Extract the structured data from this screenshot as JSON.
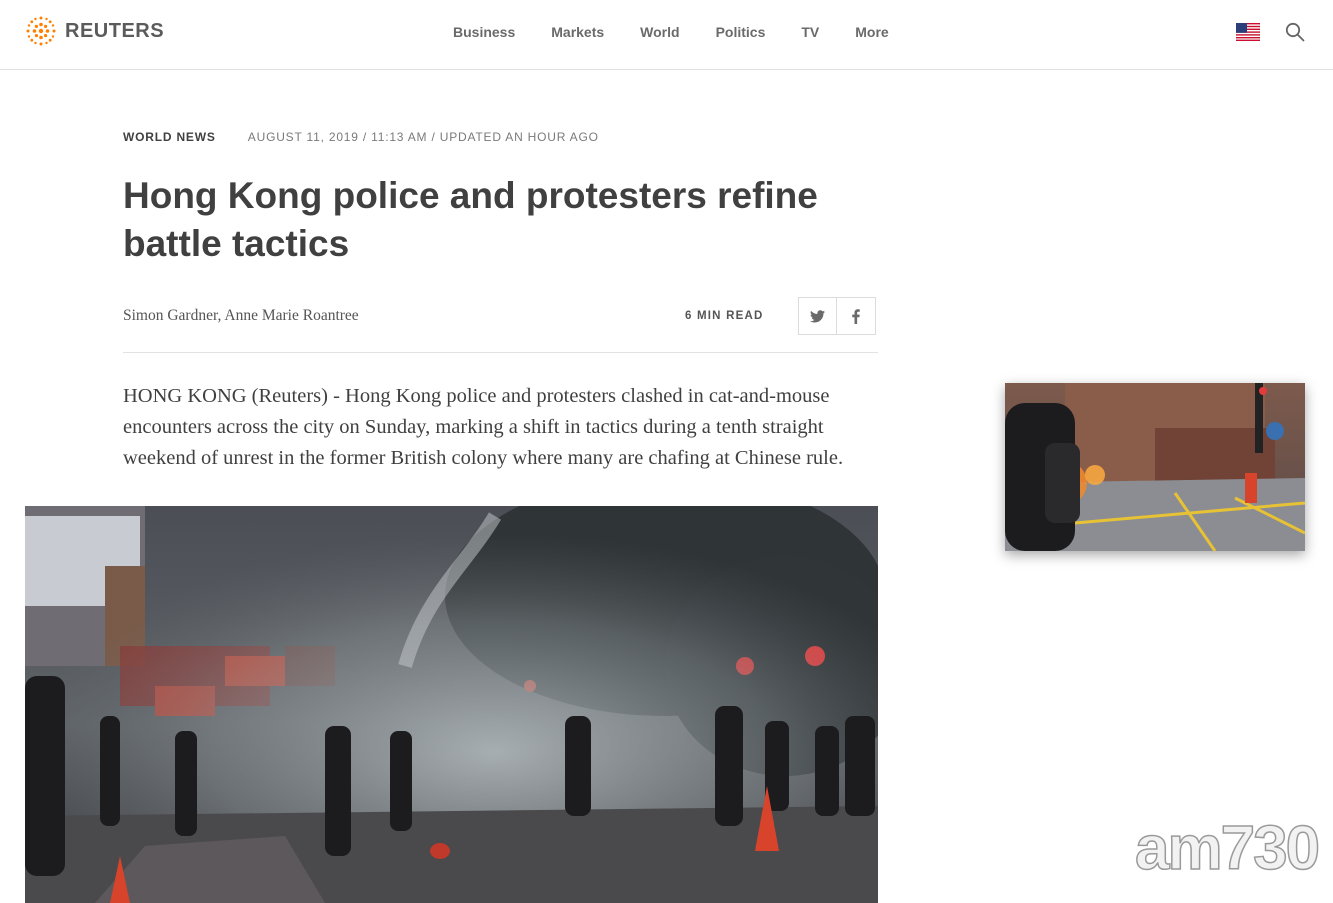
{
  "header": {
    "logo_text": "REUTERS",
    "nav": [
      "Business",
      "Markets",
      "World",
      "Politics",
      "TV",
      "More"
    ],
    "icons": {
      "flag": "us-flag-icon",
      "search": "search-icon"
    }
  },
  "article": {
    "section": "WORLD NEWS",
    "timestamp": "AUGUST 11, 2019 / 11:13 AM / UPDATED AN HOUR AGO",
    "title": "Hong Kong police and protesters refine battle tactics",
    "byline": "Simon Gardner, Anne Marie Roantree",
    "read_time": "6 MIN READ",
    "share": [
      "twitter-icon",
      "facebook-icon"
    ],
    "lead": "HONG KONG (Reuters) - Hong Kong police and protesters clashed in cat-and-mouse encounters across the city on Sunday, marking a shift in tactics during a tenth straight weekend of unrest in the former British colony where many are chafing at Chinese rule."
  },
  "watermark": "am730",
  "colors": {
    "brand_orange": "#ff8000",
    "text": "#404040",
    "muted": "#7a7a7a"
  }
}
